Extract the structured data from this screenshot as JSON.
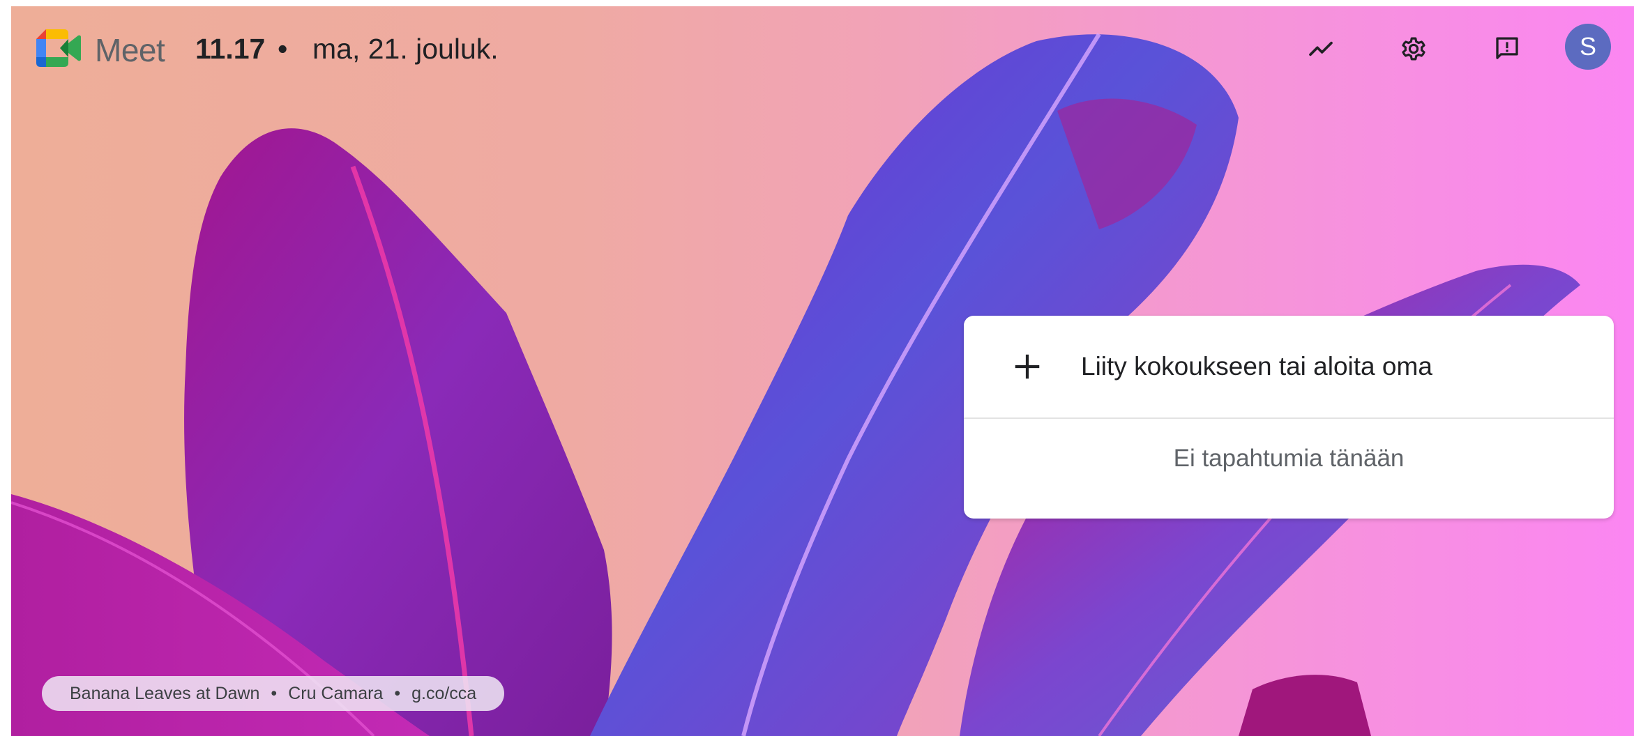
{
  "app": {
    "name": "Meet",
    "time": "11.17",
    "separator": "•",
    "date": "ma, 21. jouluk."
  },
  "header_icons": [
    {
      "icon": "trending-up-icon",
      "kind": "button"
    },
    {
      "icon": "gear-icon",
      "kind": "button"
    },
    {
      "icon": "feedback-icon",
      "kind": "button"
    }
  ],
  "account": {
    "initial": "S",
    "color": "#5c6bc0"
  },
  "card": {
    "join_label": "Liity kokoukseen tai aloita oma",
    "no_events": "Ei tapahtumia tänään"
  },
  "background": {
    "title": "Banana Leaves at Dawn",
    "author": "Cru Camara",
    "link": "g.co/cca",
    "separator": "•"
  },
  "colors": {
    "avatar": "#5c6bc0",
    "card": "#ffffff",
    "gradient_left": "#eeae98",
    "gradient_right": "#fb86f2"
  }
}
